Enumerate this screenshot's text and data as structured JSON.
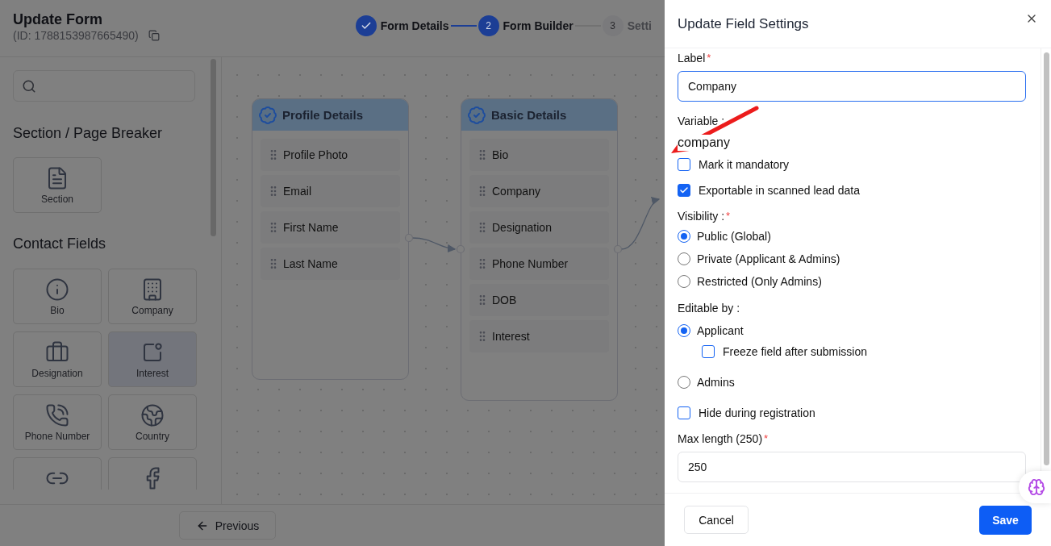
{
  "header": {
    "title": "Update Form",
    "form_id": "(ID: 1788153987665490)"
  },
  "stepper": [
    {
      "label": "Form Details",
      "completed": true,
      "selected": false
    },
    {
      "number": "2",
      "label": "Form Builder",
      "completed": false,
      "selected": true
    },
    {
      "number": "3",
      "label": "Setti",
      "completed": false,
      "selected": false
    }
  ],
  "sidebar": {
    "sections": [
      {
        "title": "Section / Page Breaker",
        "tiles": [
          {
            "label": "Section",
            "selected": false
          }
        ]
      },
      {
        "title": "Contact Fields",
        "tiles": [
          {
            "label": "Bio",
            "selected": false
          },
          {
            "label": "Company",
            "selected": false
          },
          {
            "label": "Designation",
            "selected": false
          },
          {
            "label": "Interest",
            "selected": true
          },
          {
            "label": "Phone Number",
            "selected": false
          },
          {
            "label": "Country",
            "selected": false
          },
          {
            "selected": false
          },
          {
            "selected": false
          }
        ]
      }
    ]
  },
  "canvas": {
    "nodes": [
      {
        "title": "Profile Details",
        "fields": [
          "Profile Photo",
          "Email",
          "First Name",
          "Last Name"
        ]
      },
      {
        "title": "Basic Details",
        "fields": [
          "Bio",
          "Company",
          "Designation",
          "Phone Number",
          "DOB",
          "Interest"
        ]
      }
    ]
  },
  "footer": {
    "previous": "Previous"
  },
  "drawer": {
    "title": "Update Field Settings",
    "label_field": {
      "label": "Label",
      "required_mark": "*",
      "value": "Company",
      "focused": true
    },
    "variable": {
      "label": "Variable :",
      "value": "company"
    },
    "options": [
      {
        "label": "Mark it mandatory",
        "checked": false
      },
      {
        "label": "Exportable in scanned lead data",
        "checked": true
      }
    ],
    "visibility": {
      "label": "Visibility :",
      "required_mark": "*",
      "options": [
        {
          "label": "Public (Global)",
          "selected": true
        },
        {
          "label": "Private (Applicant & Admins)",
          "selected": false
        },
        {
          "label": "Restricted (Only Admins)",
          "selected": false
        }
      ]
    },
    "editable_by": {
      "label": "Editable by :",
      "options": [
        {
          "label": "Applicant",
          "selected": true,
          "sub_option": {
            "label": "Freeze field after submission",
            "checked": false
          }
        },
        {
          "label": "Admins",
          "selected": false
        }
      ]
    },
    "hide_option": {
      "label": "Hide during registration",
      "checked": false
    },
    "max_length": {
      "label": "Max length (250)",
      "required_mark": "*",
      "value": "250"
    },
    "buttons": {
      "cancel": "Cancel",
      "save": "Save"
    }
  }
}
